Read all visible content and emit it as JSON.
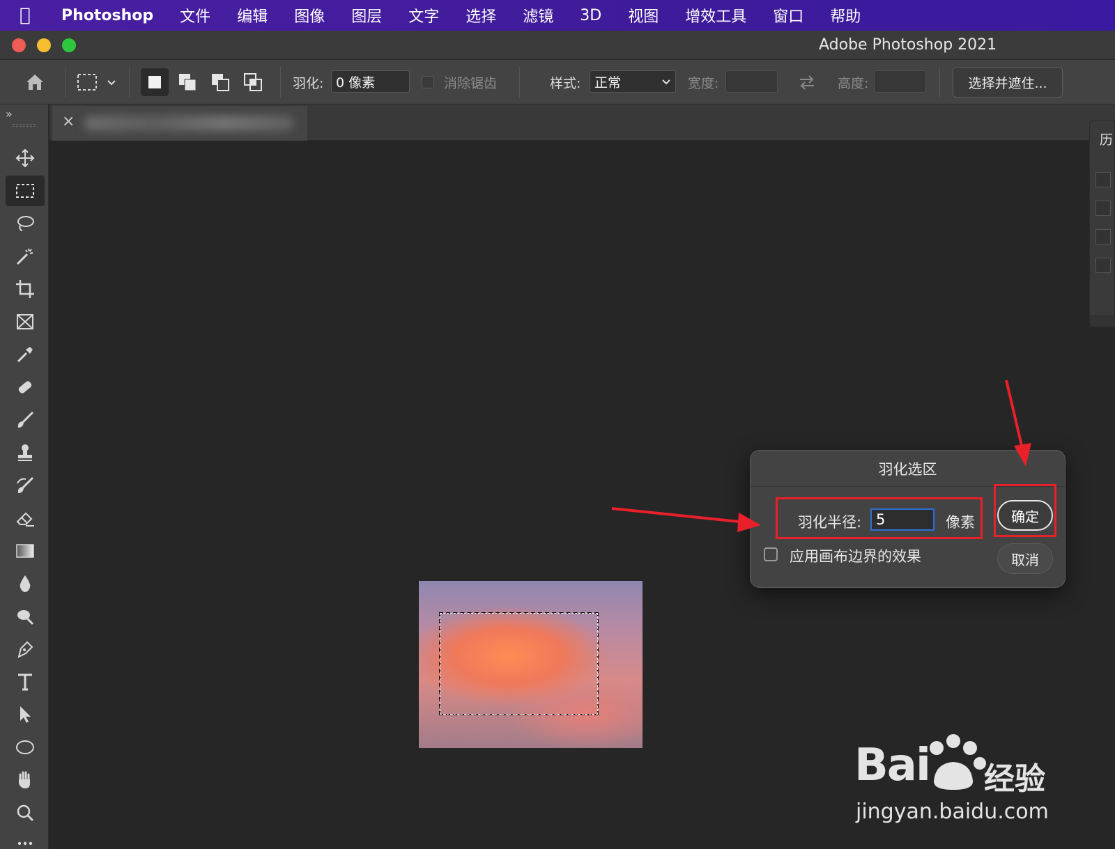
{
  "menubar": {
    "app_name": "Photoshop",
    "items": [
      "文件",
      "编辑",
      "图像",
      "图层",
      "文字",
      "选择",
      "滤镜",
      "3D",
      "视图",
      "增效工具",
      "窗口",
      "帮助"
    ]
  },
  "window": {
    "title": "Adobe Photoshop 2021"
  },
  "options": {
    "feather_label": "羽化:",
    "feather_value": "0 像素",
    "antialias_label": "消除锯齿",
    "style_label": "样式:",
    "style_value": "正常",
    "width_label": "宽度:",
    "height_label": "高度:",
    "refine_button": "选择并遮住..."
  },
  "document_tab": {
    "close_glyph": "×"
  },
  "panel": {
    "title": "历"
  },
  "dialog": {
    "title": "羽化选区",
    "radius_label": "羽化半径:",
    "radius_value": "5",
    "unit": "像素",
    "apply_canvas_label": "应用画布边界的效果",
    "ok": "确定",
    "cancel": "取消"
  },
  "watermark": {
    "logo": "Bai",
    "brand": "经验",
    "url": "jingyan.baidu.com"
  },
  "colors": {
    "annotation_red": "#e8202a",
    "focus_blue": "#2f6ed6",
    "menubar_purple": "#4a1fa3"
  }
}
